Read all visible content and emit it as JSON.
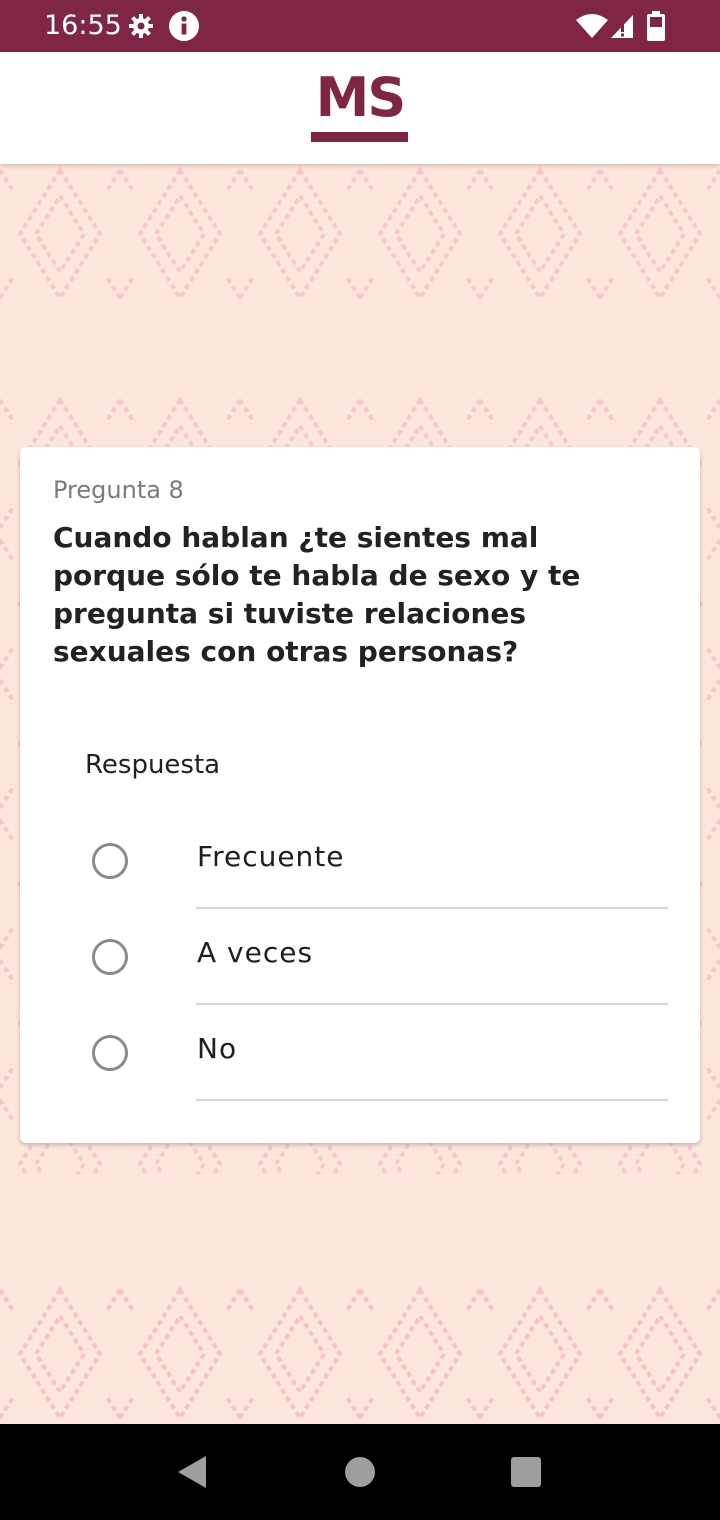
{
  "status_bar": {
    "time": "16:55",
    "icons": [
      "gear-icon",
      "info-icon",
      "wifi-icon",
      "cellular-signal-icon",
      "battery-icon"
    ],
    "background_color": "#7f2546"
  },
  "header": {
    "logo_text": "MS",
    "brand_color": "#7f2546"
  },
  "background": {
    "color": "#fde6dc",
    "pattern_color": "#f6bcc8"
  },
  "question": {
    "number_label": "Pregunta 8",
    "text": "Cuando hablan ¿te sientes mal porque sólo te habla de sexo y te pregunta si tuviste relaciones sexuales con otras personas?"
  },
  "answer": {
    "label": "Respuesta",
    "options": [
      {
        "label": "Frecuente",
        "selected": false
      },
      {
        "label": "A veces",
        "selected": false
      },
      {
        "label": "No",
        "selected": false
      }
    ]
  },
  "navigation": {
    "buttons": [
      "back-icon",
      "home-icon",
      "recents-icon"
    ]
  }
}
